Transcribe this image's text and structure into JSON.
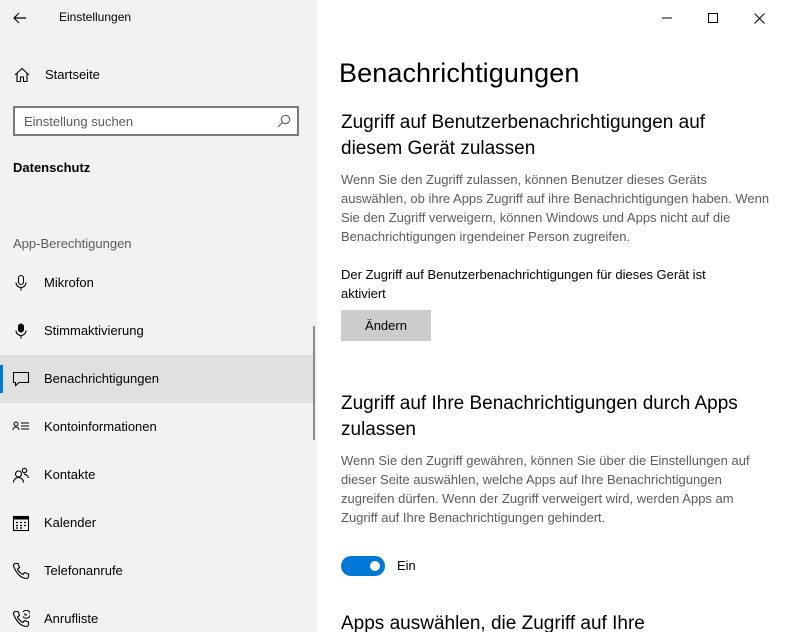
{
  "app": {
    "title": "Einstellungen"
  },
  "sidebar": {
    "home_label": "Startseite",
    "search_placeholder": "Einstellung suchen",
    "section_heading": "Datenschutz",
    "group_label": "App-Berechtigungen",
    "items": [
      {
        "label": "Mikrofon",
        "icon": "microphone-icon",
        "selected": false
      },
      {
        "label": "Stimmaktivierung",
        "icon": "voice-activation-icon",
        "selected": false
      },
      {
        "label": "Benachrichtigungen",
        "icon": "notification-icon",
        "selected": true
      },
      {
        "label": "Kontoinformationen",
        "icon": "account-info-icon",
        "selected": false
      },
      {
        "label": "Kontakte",
        "icon": "contacts-icon",
        "selected": false
      },
      {
        "label": "Kalender",
        "icon": "calendar-icon",
        "selected": false
      },
      {
        "label": "Telefonanrufe",
        "icon": "phone-icon",
        "selected": false
      },
      {
        "label": "Anrufliste",
        "icon": "call-history-icon",
        "selected": false
      }
    ]
  },
  "main": {
    "title": "Benachrichtigungen",
    "section1": {
      "heading": "Zugriff auf Benutzerbenachrichtigungen auf diesem Gerät zulassen",
      "description": "Wenn Sie den Zugriff zulassen, können Benutzer dieses Geräts auswählen, ob ihre Apps Zugriff auf ihre Benachrichtigungen haben. Wenn Sie den Zugriff verweigern, können Windows und Apps nicht auf die Benachrichtigungen irgendeiner Person zugreifen.",
      "status": "Der Zugriff auf Benutzerbenachrichtigungen für dieses Gerät ist aktiviert",
      "button_label": "Ändern"
    },
    "section2": {
      "heading": "Zugriff auf Ihre Benachrichtigungen durch Apps zulassen",
      "description": "Wenn Sie den Zugriff gewähren, können Sie über die Einstellungen auf dieser Seite auswählen, welche Apps auf Ihre Benachrichtigungen zugreifen dürfen. Wenn der Zugriff verweigert wird, werden Apps am Zugriff auf Ihre Benachrichtigungen gehindert.",
      "toggle_on": true,
      "toggle_label": "Ein"
    },
    "section3": {
      "heading": "Apps auswählen, die Zugriff auf Ihre"
    }
  },
  "colors": {
    "accent": "#0078d7",
    "sidebar_bg": "#f2f2f2",
    "selected_bg": "#e0e0e0",
    "button_bg": "#cccccc",
    "secondary_text": "#5c5c5c"
  }
}
